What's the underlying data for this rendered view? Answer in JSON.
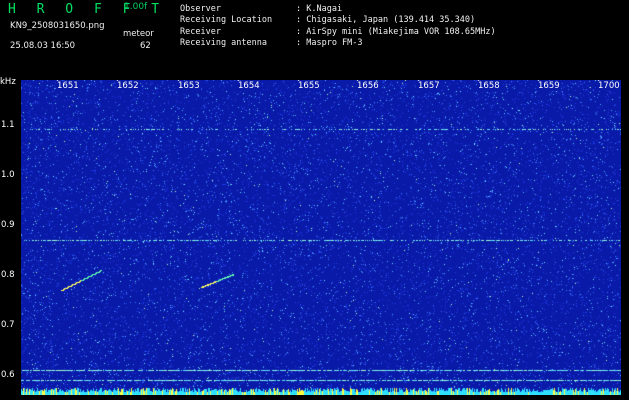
{
  "header": {
    "app_name": "H R O F F T",
    "version": "1.00f",
    "filename": "KN9_2508031650.png",
    "datetime": "25.08.03 16:50",
    "meteor_label": "meteor",
    "meteor_count": "62",
    "info": [
      {
        "key": "Observer",
        "value": ": K.Nagai"
      },
      {
        "key": "Receiving Location",
        "value": ": Chigasaki, Japan (139.414 35.340)"
      },
      {
        "key": "Receiver",
        "value": ": AirSpy mini (Miakejima VOR 108.65MHz)"
      },
      {
        "key": "Receiving antenna",
        "value": ": Maspro FM-3"
      }
    ]
  },
  "spectrogram": {
    "y_unit": "kHz",
    "y_ticks": [
      "1.1",
      "1.0",
      "0.9",
      "0.8",
      "0.7",
      "0.6"
    ],
    "x_ticks": [
      "1651",
      "1652",
      "1653",
      "1654",
      "1655",
      "1656",
      "1657",
      "1658",
      "1659",
      "1700"
    ],
    "colors": {
      "background": "#0a1aa8",
      "noise_low": "#2a4cff",
      "noise_high": "#8af0ff",
      "line": "#d0ffd0",
      "meteor": "#ffff60"
    }
  }
}
